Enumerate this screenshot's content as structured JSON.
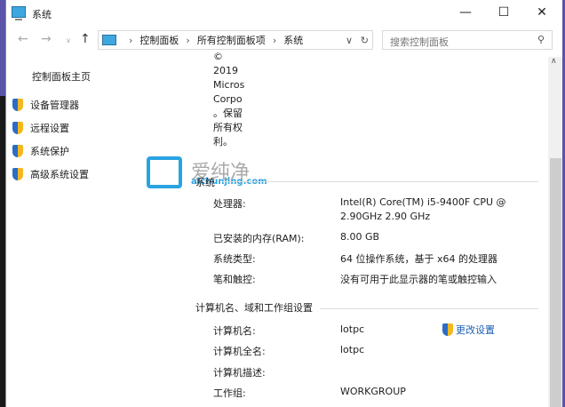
{
  "window": {
    "title": "系统"
  },
  "address": {
    "crumbs": [
      "控制面板",
      "所有控制面板项",
      "系统"
    ],
    "search_placeholder": "搜索控制面板"
  },
  "sidebar": {
    "home": "控制面板主页",
    "items": [
      {
        "label": "设备管理器"
      },
      {
        "label": "远程设置"
      },
      {
        "label": "系统保护"
      },
      {
        "label": "高级系统设置"
      }
    ]
  },
  "copyright": [
    "©",
    "2019",
    "Micros",
    "Corpo",
    "。保留",
    "所有权",
    "利。"
  ],
  "watermark": {
    "name": "爱纯净",
    "url": "aichunjing.com"
  },
  "system": {
    "header": "系统",
    "rows": [
      {
        "label": "处理器:",
        "value": "Intel(R) Core(TM) i5-9400F CPU @",
        "value2": "2.90GHz   2.90 GHz"
      },
      {
        "label": "已安装的内存(RAM):",
        "value": "8.00 GB"
      },
      {
        "label": "系统类型:",
        "value": "64 位操作系统，基于 x64 的处理器"
      },
      {
        "label": "笔和触控:",
        "value": "没有可用于此显示器的笔或触控输入"
      }
    ]
  },
  "computer": {
    "header": "计算机名、域和工作组设置",
    "change_link": "更改设置",
    "rows": [
      {
        "label": "计算机名:",
        "value": "lotpc"
      },
      {
        "label": "计算机全名:",
        "value": "lotpc"
      },
      {
        "label": "计算机描述:",
        "value": ""
      },
      {
        "label": "工作组:",
        "value": "WORKGROUP"
      }
    ]
  }
}
